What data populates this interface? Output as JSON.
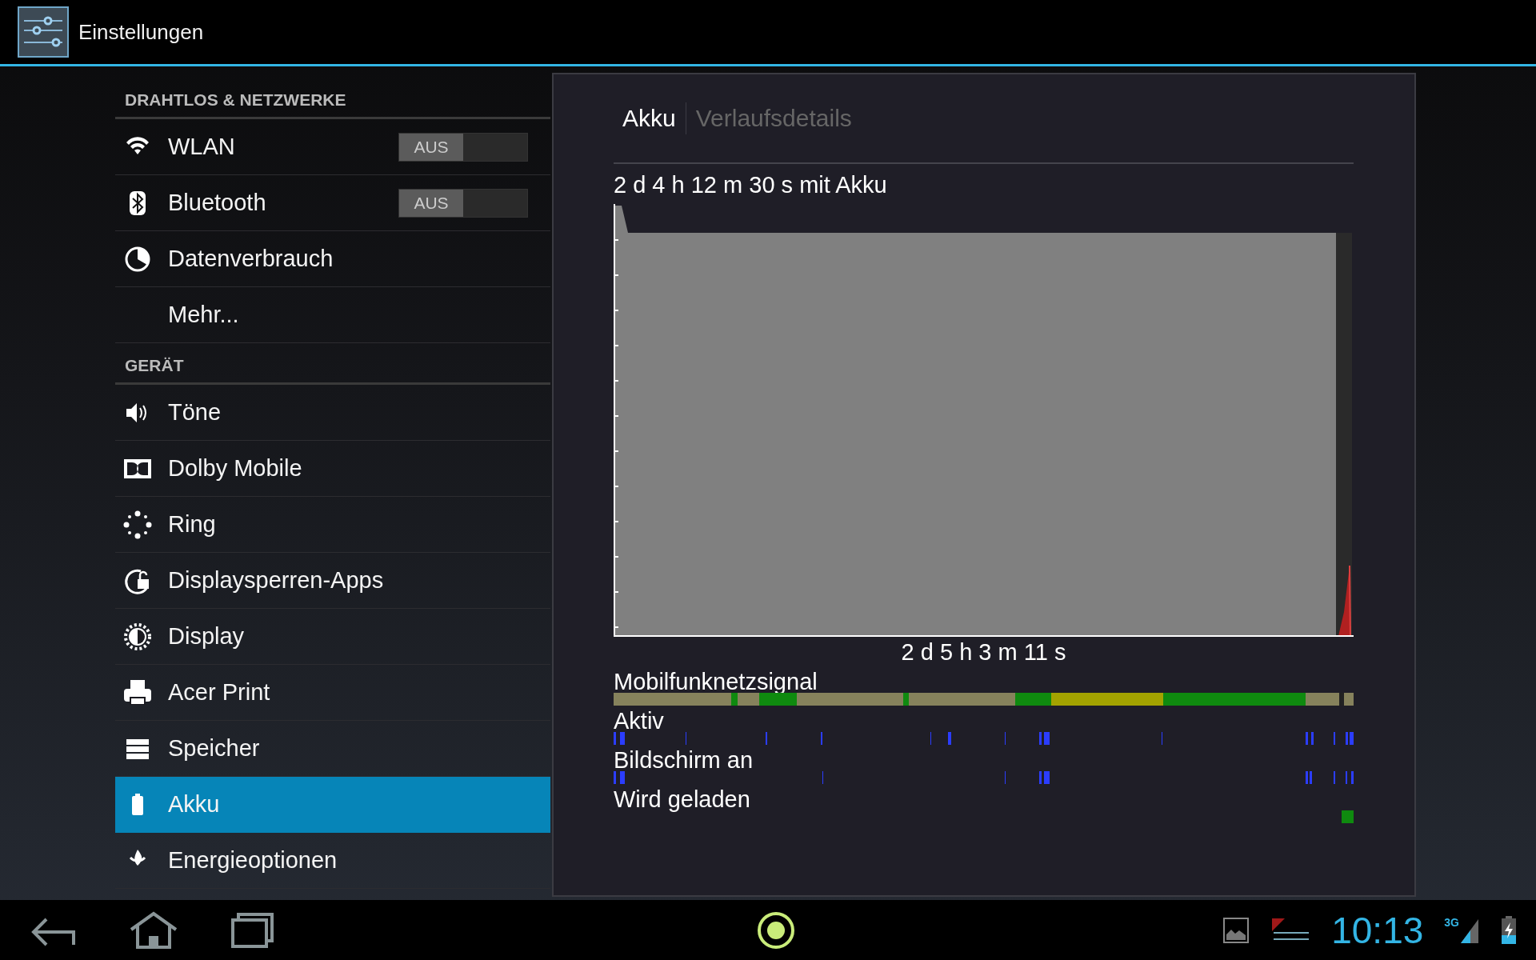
{
  "app_bar": {
    "title": "Einstellungen"
  },
  "sidebar": {
    "items": [
      {
        "kind": "header",
        "label": "DRAHTLOS & NETZWERKE"
      },
      {
        "kind": "toggle",
        "label": "WLAN",
        "selected": false,
        "toggle": {
          "label": "AUS",
          "on": false
        }
      },
      {
        "kind": "toggle",
        "label": "Bluetooth",
        "selected": false,
        "toggle": {
          "label": "AUS",
          "on": false
        }
      },
      {
        "kind": "item",
        "label": "Datenverbrauch",
        "selected": false
      },
      {
        "kind": "item",
        "label": "Mehr...",
        "selected": false
      },
      {
        "kind": "header",
        "label": "GERÄT"
      },
      {
        "kind": "item",
        "label": "Töne",
        "selected": false
      },
      {
        "kind": "item",
        "label": "Dolby Mobile",
        "selected": false
      },
      {
        "kind": "item",
        "label": "Ring",
        "selected": false
      },
      {
        "kind": "item",
        "label": "Displaysperren-Apps",
        "selected": false
      },
      {
        "kind": "item",
        "label": "Display",
        "selected": false
      },
      {
        "kind": "item",
        "label": "Acer Print",
        "selected": false
      },
      {
        "kind": "item",
        "label": "Speicher",
        "selected": false
      },
      {
        "kind": "item",
        "label": "Akku",
        "selected": true
      },
      {
        "kind": "item",
        "label": "Energieoptionen",
        "selected": false
      }
    ]
  },
  "panel": {
    "tabs": [
      {
        "label": "Akku",
        "selected": true
      },
      {
        "label": "Verlaufsdetails",
        "selected": false
      }
    ],
    "summary": "2 d 4 h 12 m 30 s mit Akku",
    "time_axis_label": "2 d 5 h 3 m 11 s",
    "timelines": [
      {
        "label": "Mobilfunknetzsignal"
      },
      {
        "label": "Aktiv"
      },
      {
        "label": "Bildschirm an"
      },
      {
        "label": "Wird geladen"
      }
    ]
  },
  "status_bar": {
    "time": "10:13",
    "network_type": "3G"
  }
}
